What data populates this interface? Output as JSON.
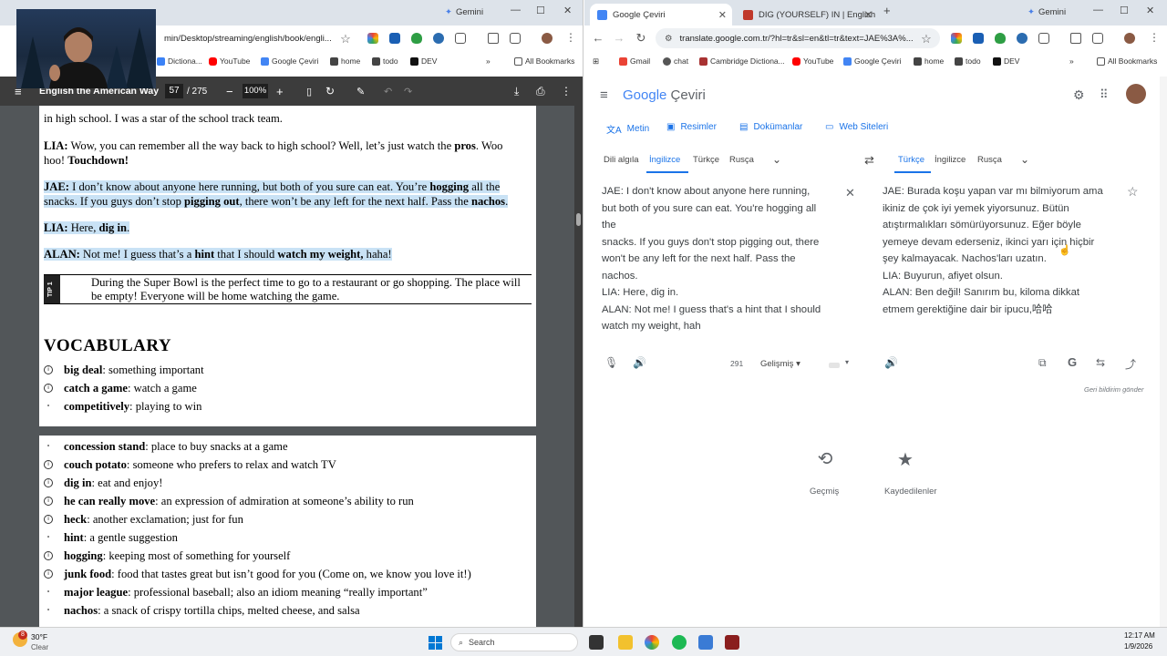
{
  "left_window": {
    "url": "min/Desktop/streaming/english/book/engli...",
    "gemini": "Gemini",
    "bookmarks": [
      "Dictiona...",
      "YouTube",
      "Google Çeviri",
      "home",
      "todo",
      "DEV"
    ],
    "more": "»",
    "all_bookmarks": "All Bookmarks",
    "pdf": {
      "title": "English the American Way",
      "page_current": "57",
      "page_total": "/ 275",
      "zoom": "100%"
    }
  },
  "book": {
    "line0": "in high school. I was a star of the school track team.",
    "lia1_speaker": "LIA:",
    "lia1_text": " Wow, you can remember all the way back to high school? Well, let’s just watch the ",
    "lia1_pros": "pros",
    "lia1_mid": ". Woo hoo! ",
    "lia1_touchdown": "Touchdown!",
    "jae_speaker": "JAE:",
    "jae_t1": " I don’t know about anyone here running, but both of you sure can eat. You’re ",
    "jae_hogging": "hogging",
    "jae_t2": " all the snacks. If you guys don’t stop ",
    "jae_pigging": "pigging out",
    "jae_t3": ", there won’t be any left for the next half. Pass the ",
    "jae_nachos": "nachos",
    "jae_t4": ".",
    "lia2_speaker": "LIA:",
    "lia2_t1": " Here, ",
    "lia2_digin": "dig in",
    "lia2_t2": ".",
    "alan_speaker": "ALAN:",
    "alan_t1": " Not me! I guess that’s a ",
    "alan_hint": "hint",
    "alan_t2": " that I should ",
    "alan_watch": "watch my weight,",
    "alan_t3": " haha!",
    "tip_label": "TIP 1",
    "tip_text": "During the Super Bowl is the perfect time to go to a restaurant or go shopping. The place will be empty! Everyone will be home watching the game.",
    "vocab_heading": "VOCABULARY",
    "vocab_top": [
      {
        "term": "big deal",
        "def": ": something important"
      },
      {
        "term": "catch a game",
        "def": ": watch a game"
      },
      {
        "term": "competitively",
        "def": ": playing to win"
      }
    ],
    "vocab_bottom": [
      {
        "term": "concession stand",
        "def": ": place to buy snacks at a game"
      },
      {
        "term": "couch potato",
        "def": ": someone who prefers to relax and watch TV"
      },
      {
        "term": "dig in",
        "def": ": eat and enjoy!"
      },
      {
        "term": "he can really move",
        "def": ": an expression of admiration at someone’s ability to run"
      },
      {
        "term": "heck",
        "def": ": another exclamation; just for fun"
      },
      {
        "term": "hint",
        "def": ": a gentle suggestion"
      },
      {
        "term": "hogging",
        "def": ": keeping most of something for yourself"
      },
      {
        "term": "junk food",
        "def": ": food that tastes great but isn’t good for you (Come on, we know you love it!)"
      },
      {
        "term": "major league",
        "def": ": professional baseball; also an idiom meaning “really important”"
      },
      {
        "term": "nachos",
        "def": ": a snack of crispy tortilla chips, melted cheese, and salsa"
      }
    ]
  },
  "right_window": {
    "tabs": [
      "Google Çeviri",
      "DIG (YOURSELF) IN | English m"
    ],
    "gemini": "Gemini",
    "url": "translate.google.com.tr/?hl=tr&sl=en&tl=tr&text=JAE%3A%...",
    "bookmarks": [
      "Gmail",
      "chat",
      "Cambridge Dictiona...",
      "YouTube",
      "Google Çeviri",
      "home",
      "todo",
      "DEV"
    ],
    "more": "»",
    "all_bookmarks": "All Bookmarks"
  },
  "translate": {
    "logo_google": "Google",
    "logo_ceviri": "Çeviri",
    "modes": [
      "Metin",
      "Resimler",
      "Dokümanlar",
      "Web Siteleri"
    ],
    "source_langs": [
      "Dili algıla",
      "İngilizce",
      "Türkçe",
      "Rusça"
    ],
    "target_langs": [
      "Türkçe",
      "İngilizce",
      "Rusça"
    ],
    "source_lines": [
      "JAE: I don't know about anyone here running,",
      "but both of you sure can eat. You're hogging all",
      "the",
      "snacks. If you guys don't stop pigging out, there",
      "won't be any left for the next half. Pass the",
      "nachos.",
      "LIA: Here, dig in.",
      "ALAN: Not me! I guess that's a hint that I should",
      "watch my weight, hah"
    ],
    "target_lines": [
      "JAE: Burada koşu yapan var mı bilmiyorum ama",
      "ikiniz de çok iyi yemek yiyorsunuz. Bütün",
      "atıştırmalıkları sömürüyorsunuz. Eğer böyle",
      "yemeye devam ederseniz, ikinci yarı için hiçbir",
      "şey kalmayacak. Nachos'ları uzatın.",
      "LIA: Buyurun, afiyet olsun.",
      "ALAN: Ben değil! Sanırım bu, kiloma dikkat",
      "etmem gerektiğine dair bir ipucu,哈哈"
    ],
    "char_count": "291",
    "advanced": "Gelişmiş",
    "feedback": "Geri bildirim gönder",
    "history": "Geçmiş",
    "saved": "Kaydedilenler"
  },
  "taskbar": {
    "weather_temp": "30°F",
    "weather_desc": "Clear",
    "weather_badge": "8",
    "search": "Search",
    "time": "12:17 AM",
    "date": "1/9/2026"
  }
}
